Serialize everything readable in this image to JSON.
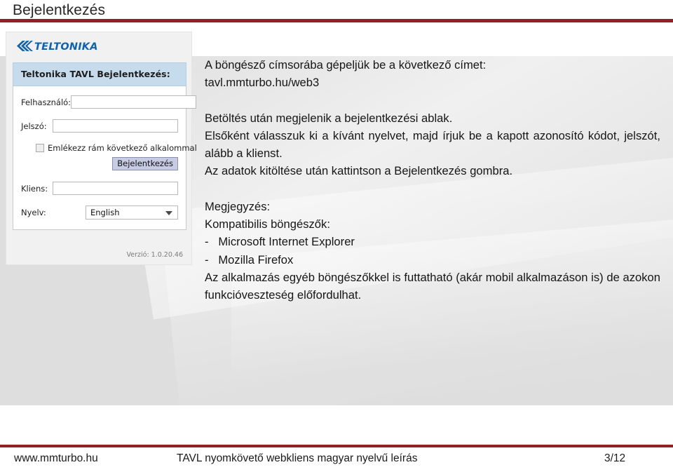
{
  "slide": {
    "title": "Bejelentkezés",
    "accent_color": "#912125",
    "content_bg": "#dedede"
  },
  "screenshot": {
    "logo_text": "TELTONIKA",
    "logo_color": "#1263ad",
    "panel_header": "Teltonika TAVL Bejelentkezés:",
    "header_bg": "#c6dced",
    "fields": [
      {
        "label": "Felhasználó:",
        "value": "",
        "placeholder": ""
      },
      {
        "label": "Jelszó:",
        "value": "",
        "placeholder": ""
      }
    ],
    "remember_label": "Emlékezz rám következő alkalommal",
    "remember_checked": false,
    "login_button": "Bejelentkezés",
    "client_field": {
      "label": "Kliens:",
      "value": "",
      "placeholder": ""
    },
    "language_field": {
      "label": "Nyelv:",
      "selected": "English",
      "options": [
        "English"
      ]
    },
    "version": "Verzió: 1.0.20.46"
  },
  "body": {
    "line1": "A böngésző címsorába gépeljük be a következő címet:",
    "line2": "tavl.mmturbo.hu/web3",
    "line3": "Betöltés után megjelenik a bejelentkezési ablak.",
    "line4": "Elsőként válasszuk ki a kívánt nyelvet, majd írjuk be a kapott azonosító kódot, jelszót, alább a klienst.",
    "line5": "Az adatok kitöltése után kattintson a Bejelentkezés gombra.",
    "note_heading": "Megjegyzés:",
    "note_sub": "Kompatibilis böngészők:",
    "browser1": "-   Microsoft Internet Explorer",
    "browser2": "-   Mozilla Firefox",
    "note_body": "Az alkalmazás egyéb böngészőkkel is futtatható (akár mobil alkalmazáson is) de azokon funkcióveszteség előfordulhat."
  },
  "footer": {
    "site": "www.mmturbo.hu",
    "doc_title": "TAVL nyomkövető webkliens magyar nyelvű leírás",
    "page": "3/12"
  }
}
